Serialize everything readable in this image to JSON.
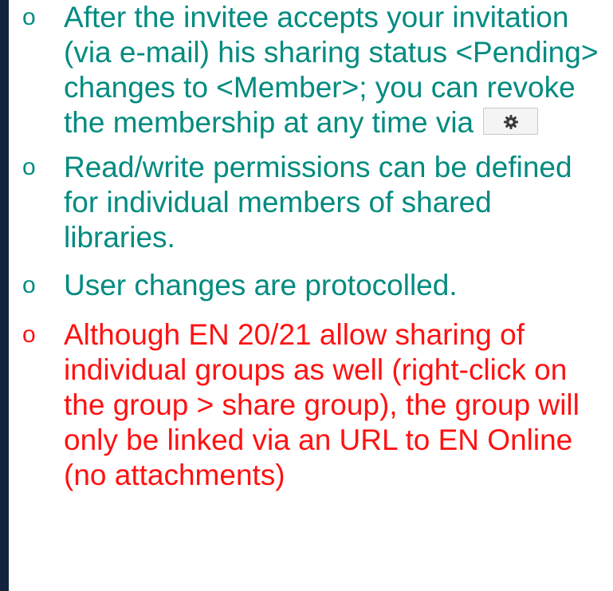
{
  "bullets": [
    {
      "marker": "o",
      "text": "After the invitee accepts your invitation (via e-mail) his sharing status <Pending> changes to <Member>; you can revoke the membership at any time via",
      "icon": "gear-icon"
    },
    {
      "marker": "o",
      "text": "Read/write permissions can be defined for individual members of shared libraries."
    },
    {
      "marker": "o",
      "text": "User changes are protocolled."
    },
    {
      "marker": "o",
      "text": "Although EN 20/21 allow sharing of individual groups as well (right-click on the group > share group), the group will only be linked via an URL to EN Online (no attachments)"
    }
  ],
  "colors": {
    "text_teal": "#008b80",
    "text_red": "#ff1111",
    "side_bar": "#13223e"
  }
}
